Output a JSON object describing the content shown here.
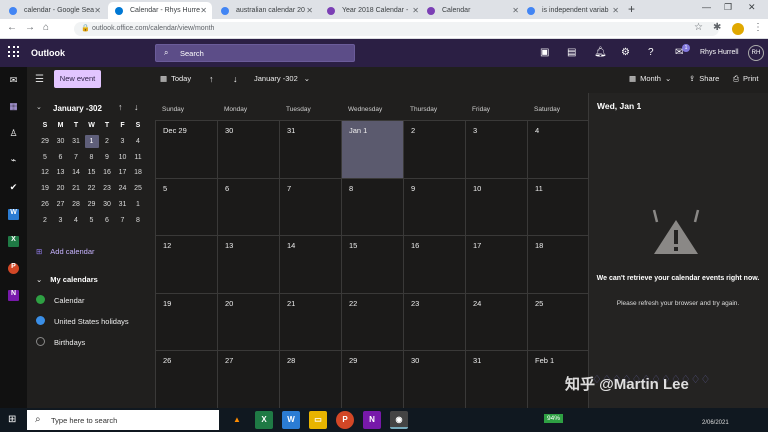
{
  "browser": {
    "tabs": [
      {
        "title": "calendar - Google Sea",
        "icon": "google-icon",
        "active": false
      },
      {
        "title": "Calendar - Rhys Hurre",
        "icon": "outlook-icon",
        "active": true
      },
      {
        "title": "australian calendar 20",
        "icon": "google-icon",
        "active": false
      },
      {
        "title": "Year 2018 Calendar -",
        "icon": "calendar-site-icon",
        "active": false
      },
      {
        "title": "Calendar",
        "icon": "calendar-site-icon",
        "active": false
      },
      {
        "title": "is independent variab",
        "icon": "google-icon",
        "active": false
      }
    ],
    "url": "outlook.office.com/calendar/view/month"
  },
  "header": {
    "app_name": "Outlook",
    "search_placeholder": "Search",
    "user_name": "Rhys Hurrell",
    "user_initials": "RH",
    "notification_count": "1"
  },
  "left_pane": {
    "new_event": "New event",
    "mini_month_title": "January -302",
    "weekday_headers": [
      "S",
      "M",
      "T",
      "W",
      "T",
      "F",
      "S"
    ],
    "weeks": [
      [
        "29",
        "30",
        "31",
        "1",
        "2",
        "3",
        "4"
      ],
      [
        "5",
        "6",
        "7",
        "8",
        "9",
        "10",
        "11"
      ],
      [
        "12",
        "13",
        "14",
        "15",
        "16",
        "17",
        "18"
      ],
      [
        "19",
        "20",
        "21",
        "22",
        "23",
        "24",
        "25"
      ],
      [
        "26",
        "27",
        "28",
        "29",
        "30",
        "31",
        "1"
      ],
      [
        "2",
        "3",
        "4",
        "5",
        "6",
        "7",
        "8"
      ]
    ],
    "add_calendar": "Add calendar",
    "my_calendars": "My calendars",
    "calendars": [
      {
        "name": "Calendar",
        "color": "#2ea043"
      },
      {
        "name": "United States holidays",
        "color": "#3a8ee6"
      },
      {
        "name": "Birthdays",
        "color": "#888888"
      }
    ]
  },
  "toolbar": {
    "today": "Today",
    "range": "January -302",
    "view": "Month",
    "share": "Share",
    "print": "Print"
  },
  "calendar": {
    "days": [
      "Sunday",
      "Monday",
      "Tuesday",
      "Wednesday",
      "Thursday",
      "Friday",
      "Saturday"
    ],
    "weeks": [
      [
        "Dec 29",
        "30",
        "31",
        "Jan 1",
        "2",
        "3",
        "4"
      ],
      [
        "5",
        "6",
        "7",
        "8",
        "9",
        "10",
        "11"
      ],
      [
        "12",
        "13",
        "14",
        "15",
        "16",
        "17",
        "18"
      ],
      [
        "19",
        "20",
        "21",
        "22",
        "23",
        "24",
        "25"
      ],
      [
        "26",
        "27",
        "28",
        "29",
        "30",
        "31",
        "Feb 1"
      ]
    ]
  },
  "right_pane": {
    "date": "Wed, Jan 1",
    "error_title": "We can't retrieve your calendar events right now.",
    "error_sub": "Please refresh your browser and try again."
  },
  "watermark": "知乎 @Martin Lee",
  "taskbar": {
    "search_placeholder": "Type here to search",
    "battery": "94%",
    "date": "2/06/2021"
  }
}
